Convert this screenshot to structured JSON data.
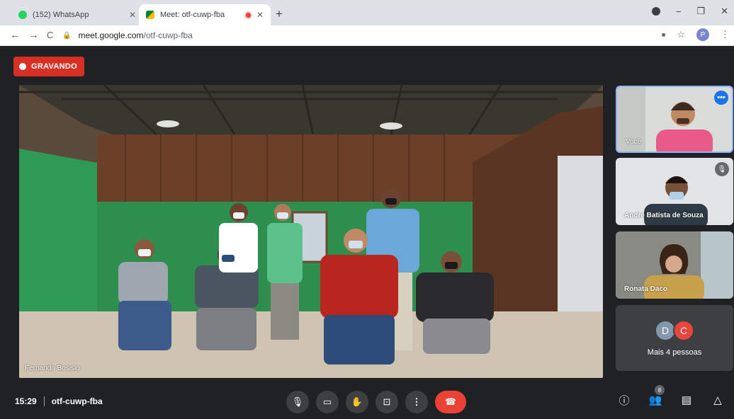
{
  "browser": {
    "tabs": [
      {
        "title": "(152) WhatsApp",
        "close": "✕",
        "favicon_color": "#25d366"
      },
      {
        "title": "Meet: otf-cuwp-fba",
        "close": "✕",
        "favicon_color": "#00832d"
      }
    ],
    "new_tab": "+",
    "window_controls": {
      "minimize": "−",
      "maximize": "❐",
      "close": "✕"
    },
    "nav": {
      "back": "←",
      "forward": "→",
      "reload": "C"
    },
    "url_host": "meet.google.com",
    "url_path": "/otf-cuwp-fba",
    "profile_initial": "P",
    "star": "☆",
    "menu": "⋮",
    "video_ext": "■"
  },
  "meet": {
    "recording_label": "GRAVANDO",
    "main_participant": "Fernando Bosisio",
    "tiles": [
      {
        "name": "Você",
        "more": "•••"
      },
      {
        "name": "Andre Batista de Souza",
        "mute": "🎙"
      },
      {
        "name": "Ronata Daco"
      }
    ],
    "more_people": {
      "avatars": [
        "D",
        "C"
      ],
      "label": "Mais 4 pessoas"
    },
    "bottom": {
      "time": "15:29",
      "meeting_code": "otf-cuwp-fba",
      "controls": {
        "mic": "🎙",
        "camera": "▭",
        "hand": "✋",
        "present": "⊡",
        "more": "⋮",
        "hangup": "☎"
      },
      "right": {
        "info": "ⓘ",
        "people": "👥",
        "people_count": "8",
        "chat": "▤",
        "activities": "△"
      }
    }
  },
  "colors": {
    "recording": "#d93025",
    "hangup": "#ea4335",
    "active_tile_border": "#8ab4f8"
  }
}
